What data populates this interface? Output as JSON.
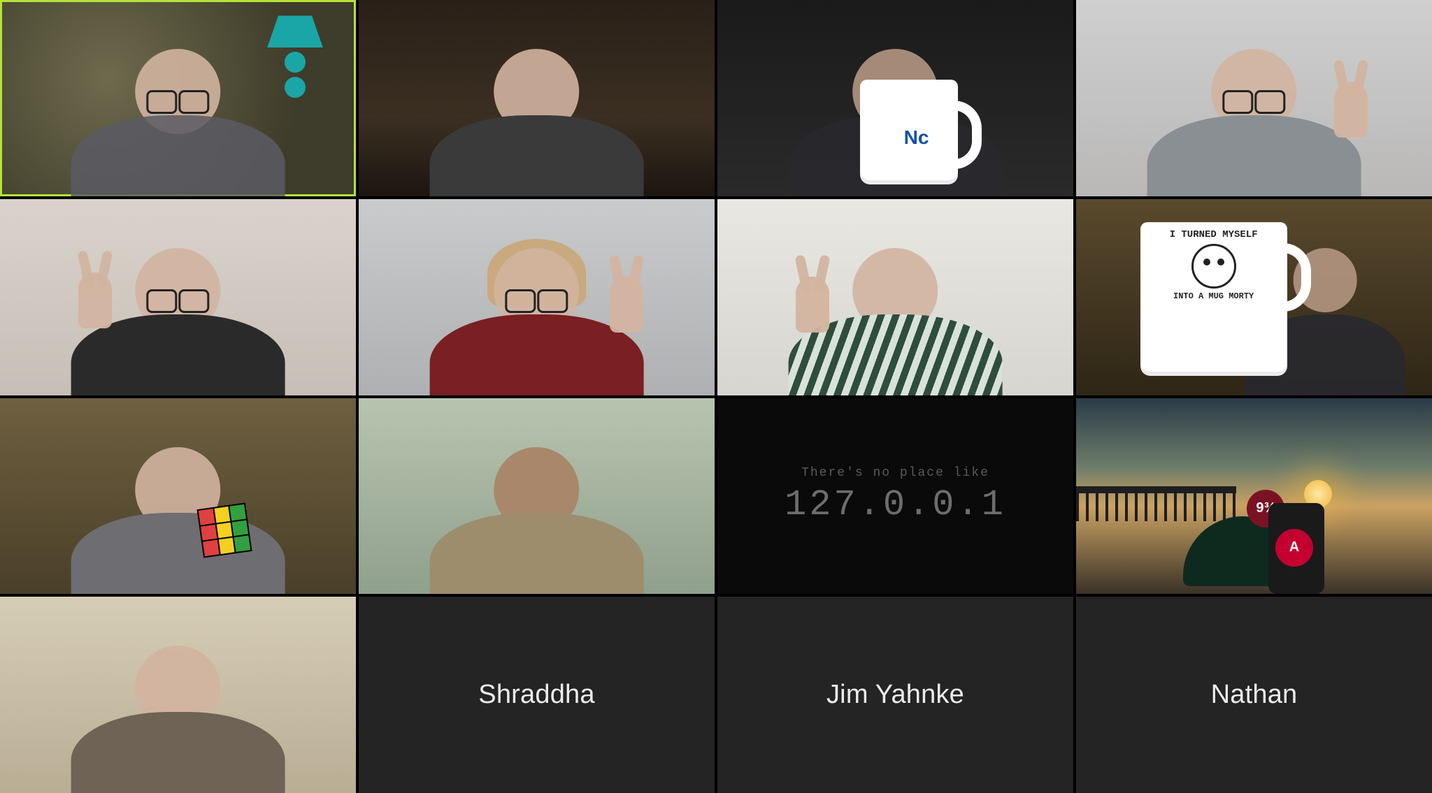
{
  "gallery": {
    "columns": 4,
    "rows": 4,
    "active_speaker_index": 0
  },
  "tiles": [
    {
      "type": "video",
      "desc": "participant-1",
      "active": true
    },
    {
      "type": "video",
      "desc": "participant-2"
    },
    {
      "type": "video",
      "desc": "participant-3",
      "mug_logo": "Nc"
    },
    {
      "type": "video",
      "desc": "participant-4"
    },
    {
      "type": "video",
      "desc": "participant-5"
    },
    {
      "type": "video",
      "desc": "participant-6"
    },
    {
      "type": "video",
      "desc": "participant-7"
    },
    {
      "type": "video",
      "desc": "participant-8",
      "mug_line1": "I TURNED MYSELF",
      "mug_line2": "INTO A MUG MORTY"
    },
    {
      "type": "video",
      "desc": "participant-9"
    },
    {
      "type": "video",
      "desc": "participant-10"
    },
    {
      "type": "video",
      "desc": "participant-11-camera-off",
      "term_line1": "There's no place like",
      "term_line2": "127.0.0.1"
    },
    {
      "type": "video",
      "desc": "participant-12",
      "badge1": "9¾",
      "badge2": "A"
    },
    {
      "type": "video",
      "desc": "participant-13"
    },
    {
      "type": "name",
      "label": "Shraddha"
    },
    {
      "type": "name",
      "label": "Jim Yahnke"
    },
    {
      "type": "name",
      "label": "Nathan"
    }
  ]
}
